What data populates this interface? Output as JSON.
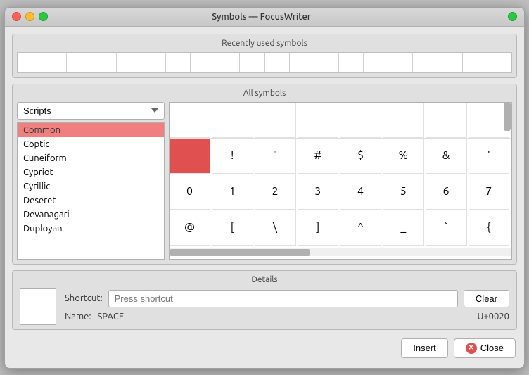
{
  "window": {
    "title": "Symbols — FocusWriter",
    "controls": {
      "close": "close",
      "minimize": "minimize",
      "maximize": "maximize"
    }
  },
  "recently_used": {
    "title": "Recently used symbols",
    "cells": 20
  },
  "all_symbols": {
    "title": "All symbols",
    "dropdown": {
      "value": "Scripts",
      "label": "Scripts"
    },
    "scripts": [
      "Common",
      "Coptic",
      "Cuneiform",
      "Cypriot",
      "Cyrillic",
      "Deseret",
      "Devanagari",
      "Duployan"
    ],
    "selected_script": "Common",
    "grid_rows": [
      [
        "",
        " ",
        "!",
        "\"",
        "#",
        "$",
        "%",
        "&",
        "'"
      ],
      [
        "0",
        "1",
        "2",
        "3",
        "4",
        "5",
        "6",
        "7"
      ],
      [
        "@",
        "[",
        "\\",
        "]",
        "^",
        "_",
        "`",
        "{"
      ]
    ]
  },
  "details": {
    "title": "Details",
    "shortcut_label": "Shortcut:",
    "shortcut_placeholder": "Press shortcut",
    "clear_label": "Clear",
    "name_label": "Name:",
    "name_value": "SPACE",
    "unicode_value": "U+0020"
  },
  "footer": {
    "insert_label": "Insert",
    "close_label": "Close"
  }
}
